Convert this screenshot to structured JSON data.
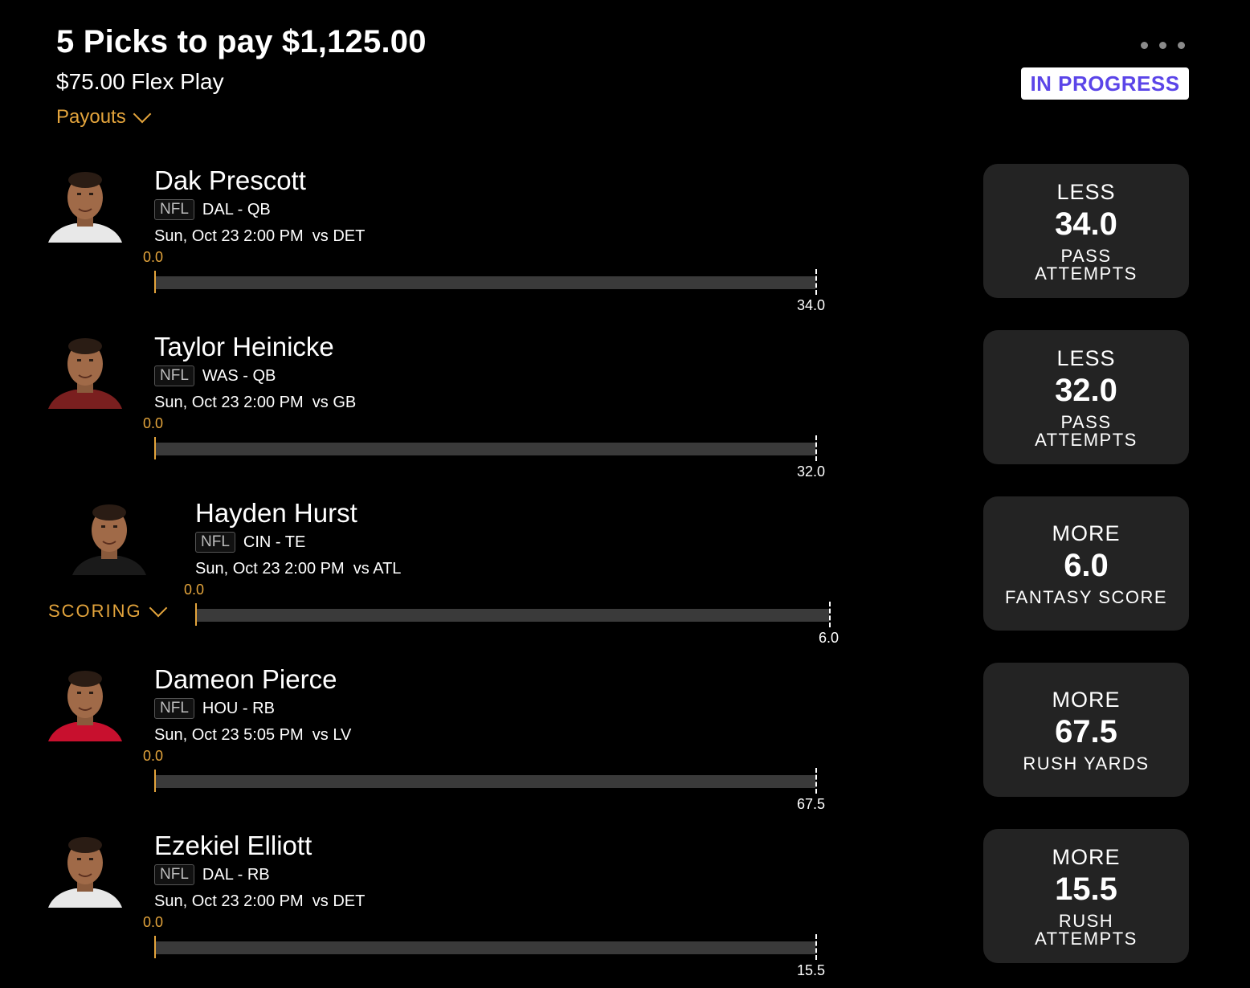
{
  "header": {
    "title": "5 Picks to pay $1,125.00",
    "subtitle": "$75.00 Flex Play",
    "payouts_label": "Payouts",
    "status": "IN PROGRESS"
  },
  "scoring_label": "SCORING",
  "picks": [
    {
      "name": "Dak Prescott",
      "league": "NFL",
      "team_pos": "DAL - QB",
      "game": "Sun, Oct 23 2:00 PM  vs DET",
      "start": "0.0",
      "target": "34.0",
      "direction": "LESS",
      "line": "34.0",
      "stat": "PASS\nATTEMPTS",
      "jersey_color": "#e8e8e8"
    },
    {
      "name": "Taylor Heinicke",
      "league": "NFL",
      "team_pos": "WAS - QB",
      "game": "Sun, Oct 23 2:00 PM  vs GB",
      "start": "0.0",
      "target": "32.0",
      "direction": "LESS",
      "line": "32.0",
      "stat": "PASS\nATTEMPTS",
      "jersey_color": "#7a1f1f"
    },
    {
      "name": "Hayden Hurst",
      "league": "NFL",
      "team_pos": "CIN - TE",
      "game": "Sun, Oct 23 2:00 PM  vs ATL",
      "start": "0.0",
      "target": "6.0",
      "direction": "MORE",
      "line": "6.0",
      "stat": "FANTASY SCORE",
      "jersey_color": "#1a1a1a"
    },
    {
      "name": "Dameon Pierce",
      "league": "NFL",
      "team_pos": "HOU - RB",
      "game": "Sun, Oct 23 5:05 PM  vs LV",
      "start": "0.0",
      "target": "67.5",
      "direction": "MORE",
      "line": "67.5",
      "stat": "RUSH YARDS",
      "jersey_color": "#c8102e"
    },
    {
      "name": "Ezekiel Elliott",
      "league": "NFL",
      "team_pos": "DAL - RB",
      "game": "Sun, Oct 23 2:00 PM  vs DET",
      "start": "0.0",
      "target": "15.5",
      "direction": "MORE",
      "line": "15.5",
      "stat": "RUSH\nATTEMPTS",
      "jersey_color": "#e8e8e8"
    }
  ]
}
